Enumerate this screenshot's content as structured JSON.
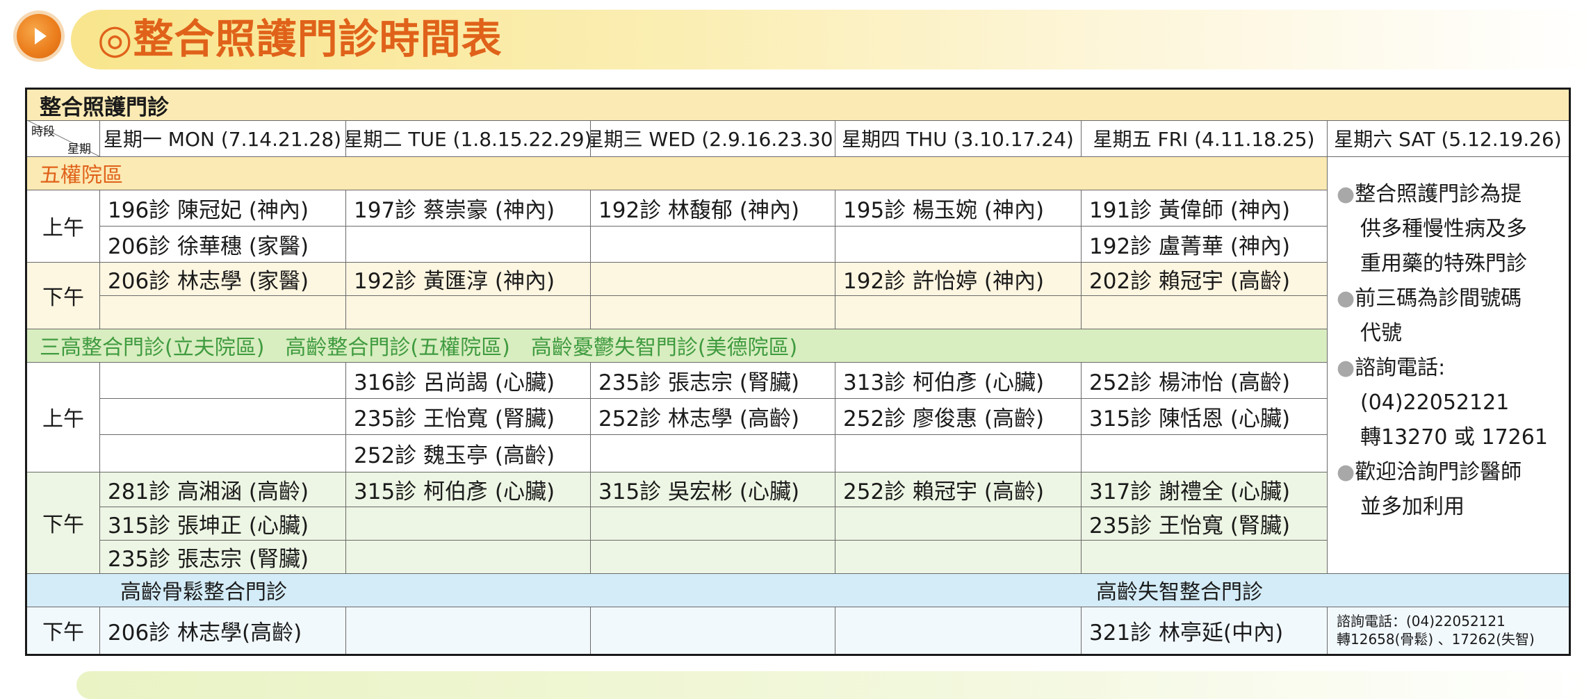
{
  "page": {
    "title": "◎整合照護門診時間表"
  },
  "colors": {
    "orange": "#e0621a",
    "title_bg": "#f8e58d",
    "section_yellow": "#fbeab4",
    "section_green": "#d8edc0",
    "section_blue": "#d4ecf7"
  },
  "table": {
    "heading": "整合照護門診",
    "corner_top": "時段",
    "corner_bottom": "星期",
    "days": [
      "星期一 MON (7.14.21.28)",
      "星期二 TUE (1.8.15.22.29)",
      "星期三 WED (2.9.16.23.30)",
      "星期四 THU (3.10.17.24)",
      "星期五 FRI (4.11.18.25)",
      "星期六 SAT (5.12.19.26)"
    ],
    "sections": {
      "wuquan": {
        "title": "五權院區",
        "am_label": "上午",
        "pm_label": "下午",
        "am": [
          [
            "196診 陳冠妃 (神內)",
            "197診 蔡崇豪 (神內)",
            "192診 林馥郁 (神內)",
            "195診 楊玉婉 (神內)",
            "191診 黃偉師 (神內)"
          ],
          [
            "206診 徐華穗 (家醫)",
            "",
            "",
            "",
            "192診 盧菁華 (神內)"
          ]
        ],
        "pm": [
          [
            "206診 林志學 (家醫)",
            "192診 黃匯淳 (神內)",
            "",
            "192診 許怡婷 (神內)",
            "202診 賴冠宇 (高齡)"
          ],
          [
            "",
            "",
            "",
            "",
            ""
          ]
        ]
      },
      "sangao": {
        "title": "三高整合門診(立夫院區)　高齡整合門診(五權院區)　高齡憂鬱失智門診(美德院區)",
        "am_label": "上午",
        "pm_label": "下午",
        "am": [
          [
            "",
            "316診 呂尚謁 (心臟)",
            "235診 張志宗 (腎臟)",
            "313診 柯伯彥 (心臟)",
            "252診 楊沛怡 (高齡)"
          ],
          [
            "",
            "235診 王怡寬 (腎臟)",
            "252診 林志學 (高齡)",
            "252診 廖俊惠 (高齡)",
            "315診 陳恬恩 (心臟)"
          ],
          [
            "",
            "252診 魏玉亭 (高齡)",
            "",
            "",
            ""
          ]
        ],
        "pm": [
          [
            "281診 高湘涵 (高齡)",
            "315診 柯伯彥 (心臟)",
            "315診 吳宏彬 (心臟)",
            "252診 賴冠宇 (高齡)",
            "317診 謝禮全 (心臟)"
          ],
          [
            "315診 張坤正 (心臟)",
            "",
            "",
            "",
            "235診 王怡寬 (腎臟)"
          ],
          [
            "235診 張志宗 (腎臟)",
            "",
            "",
            "",
            ""
          ]
        ]
      },
      "bone": {
        "title_left": "高齡骨鬆整合門診",
        "title_right": "高齡失智整合門診",
        "pm_label": "下午",
        "pm": [
          "206診 林志學(高齡)",
          "",
          "",
          "",
          "321診 林亭延(中內)"
        ],
        "contact_line1": "諮詢電話：(04)22052121",
        "contact_line2": "轉12658(骨鬆) 、17262(失智)"
      }
    },
    "notes": [
      {
        "bullet": "●",
        "lines": [
          "整合照護門診為提",
          "供多種慢性病及多",
          "重用藥的特殊門診"
        ]
      },
      {
        "bullet": "●",
        "lines": [
          "前三碼為診間號碼",
          "代號"
        ]
      },
      {
        "bullet": "●",
        "lines": [
          "諮詢電話:",
          "(04)22052121",
          "轉13270 或 17261"
        ]
      },
      {
        "bullet": "●",
        "lines": [
          "歡迎洽詢門診醫師",
          "並多加利用"
        ]
      }
    ]
  }
}
